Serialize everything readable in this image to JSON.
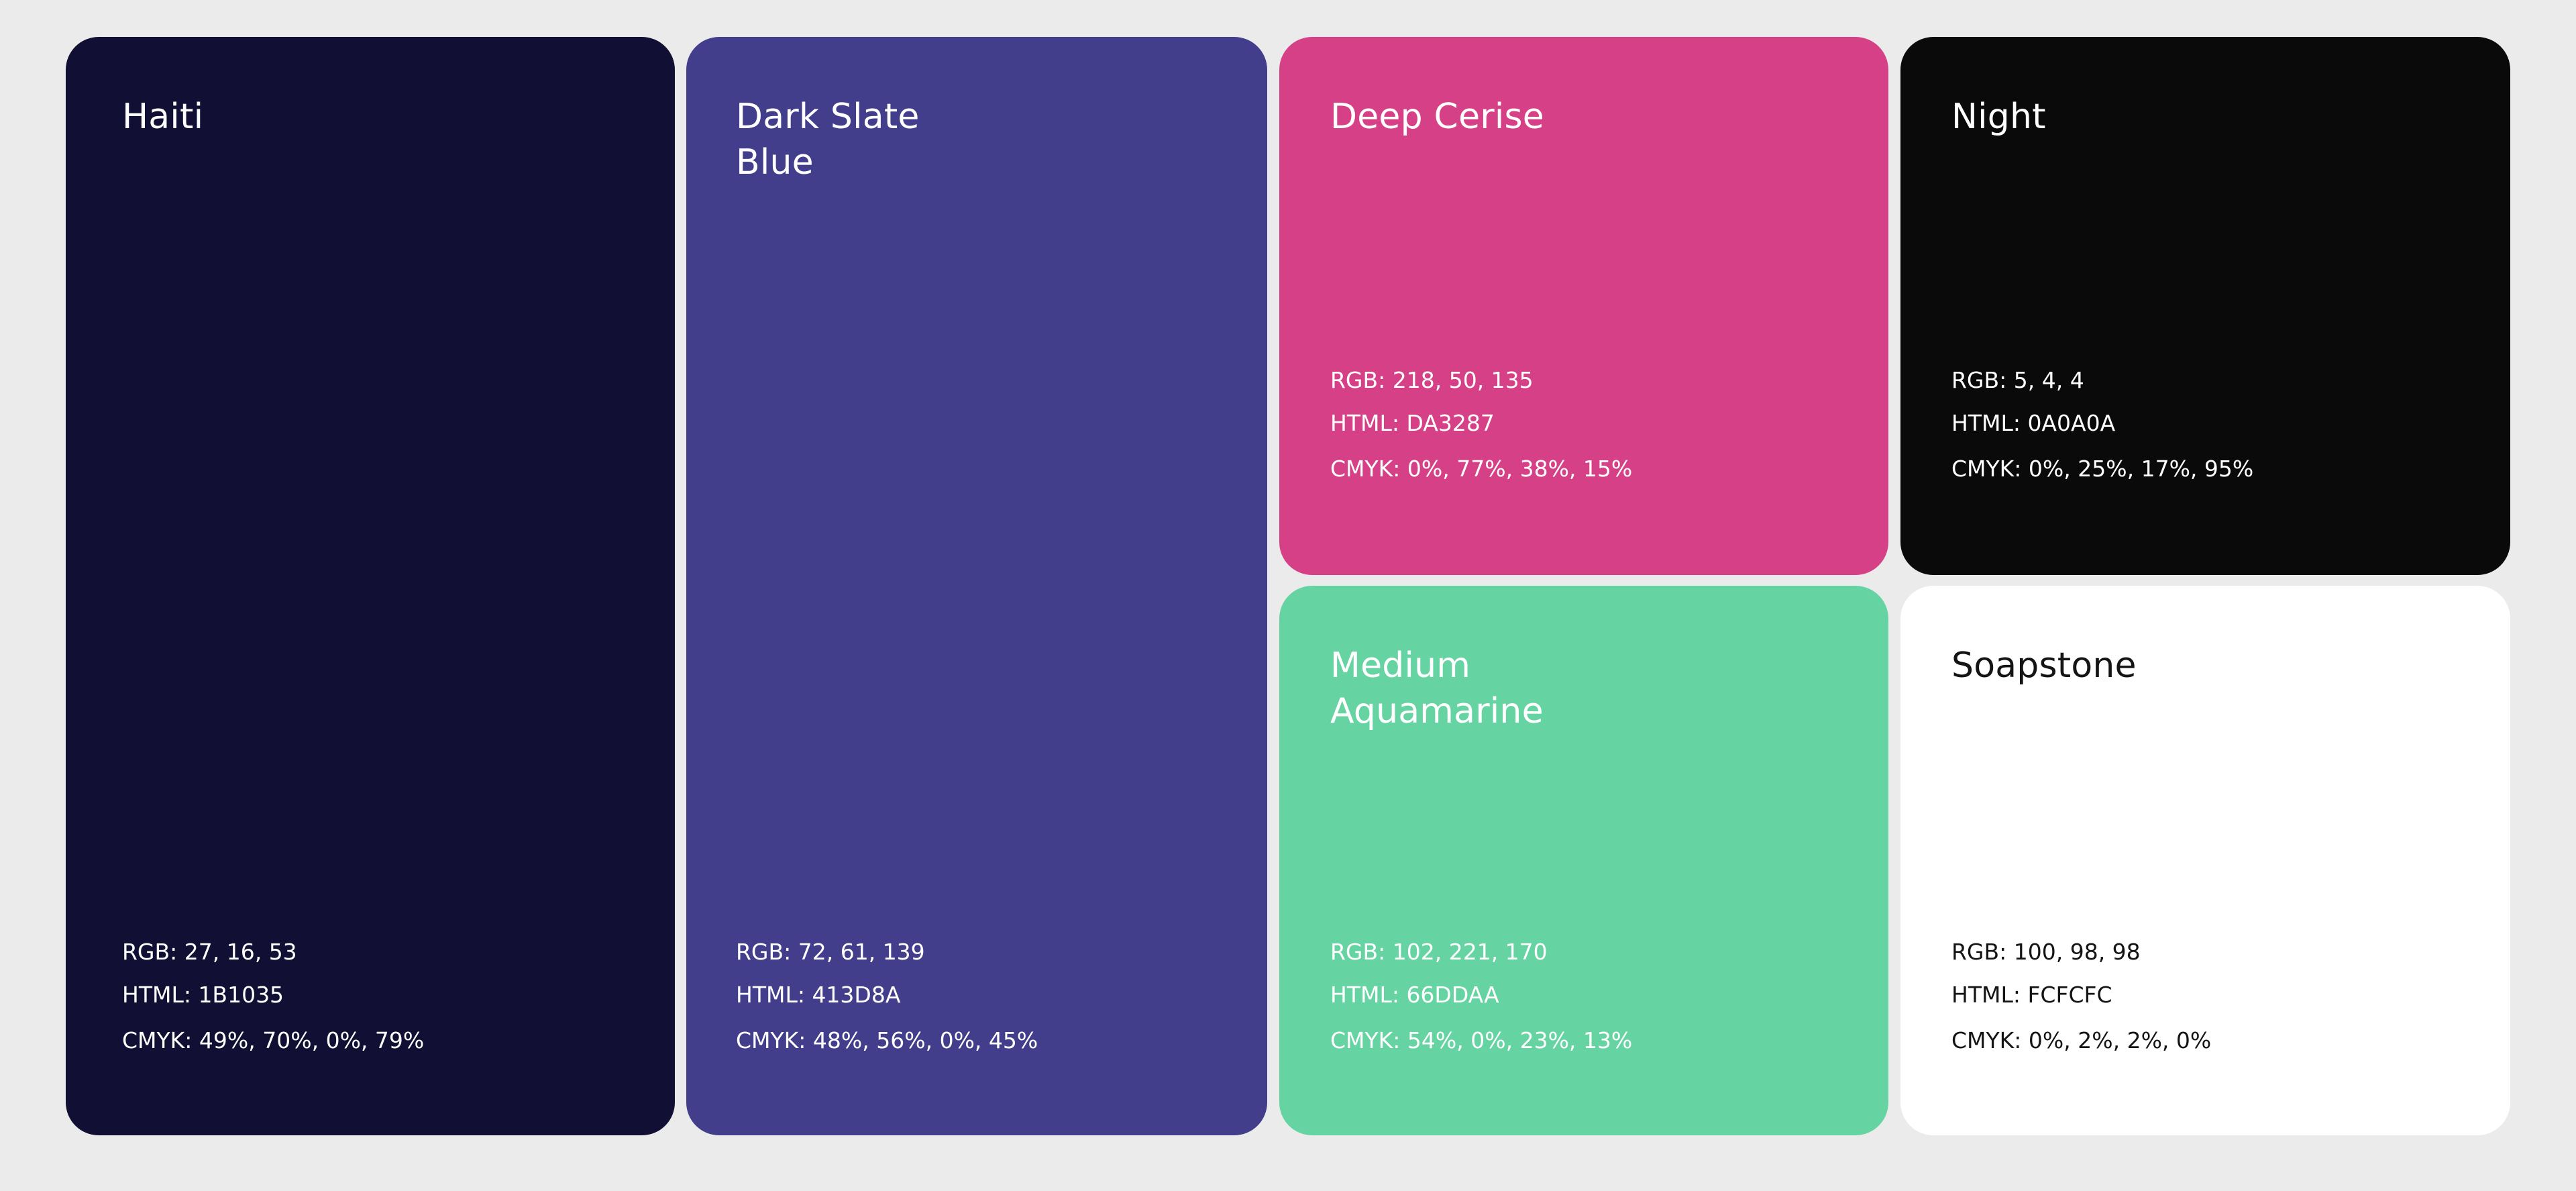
{
  "swatches": {
    "haiti": {
      "name": "Haiti",
      "rgb": "RGB: 27, 16, 53",
      "html": "HTML: 1B1035",
      "cmyk": "CMYK: 49%, 70%, 0%, 79%",
      "color": "#110f33",
      "text_color": "#ffffff"
    },
    "dark_slate_blue": {
      "name": "Dark Slate\nBlue",
      "rgb": "RGB: 72, 61, 139",
      "html": "HTML: 413D8A",
      "cmyk": "CMYK: 48%, 56%, 0%, 45%",
      "color": "#433e8b",
      "text_color": "#ffffff"
    },
    "deep_cerise": {
      "name": "Deep Cerise",
      "rgb": "RGB: 218, 50, 135",
      "html": "HTML: DA3287",
      "cmyk": "CMYK: 0%, 77%, 38%, 15%",
      "color": "#d64087",
      "text_color": "#ffffff"
    },
    "night": {
      "name": "Night",
      "rgb": "RGB: 5, 4, 4",
      "html": "HTML: 0A0A0A",
      "cmyk": "CMYK: 0%, 25%, 17%, 95%",
      "color": "#0a0a0a",
      "text_color": "#ffffff"
    },
    "medium_aquamarine": {
      "name": "Medium\nAquamarine",
      "rgb": "RGB: 102, 221, 170",
      "html": "HTML: 66DDAA",
      "cmyk": "CMYK: 54%, 0%, 23%, 13%",
      "color": "#66d4a2",
      "text_color": "#ffffff"
    },
    "soapstone": {
      "name": "Soapstone",
      "rgb": "RGB: 100, 98, 98",
      "html": "HTML: FCFCFC",
      "cmyk": "CMYK: 0%, 2%, 2%, 0%",
      "color": "#ffffff",
      "text_color": "#141414"
    }
  },
  "page_background": "#ebebeb"
}
